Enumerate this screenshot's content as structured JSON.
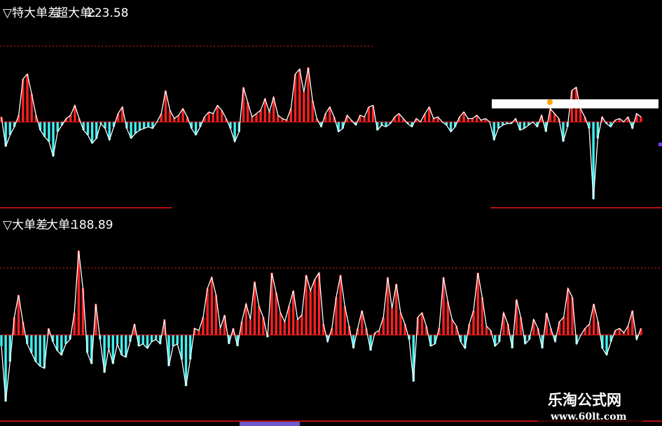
{
  "colors": {
    "background": "#000000",
    "positive": "#ff2020",
    "negative": "#40f0f0",
    "line": "#ffffff",
    "dotted": "#c01818",
    "separator": "#b01010",
    "text": "#ffffff"
  },
  "chart_data": [
    {
      "type": "bar",
      "panel_title": "▽特大单差",
      "readout_label": "超大单:",
      "readout_value": "223.58",
      "values": [
        0.3,
        -1.5,
        -0.8,
        -0.3,
        0.4,
        2.6,
        2.9,
        1.7,
        0.4,
        -0.5,
        -0.9,
        -1.2,
        -2.1,
        -0.6,
        -0.2,
        0.2,
        0.4,
        1.0,
        0.2,
        -0.5,
        -0.8,
        -1.3,
        -1.0,
        -0.1,
        -0.4,
        -1.1,
        -0.3,
        0.5,
        0.9,
        -0.4,
        -1.0,
        -0.7,
        -0.5,
        -0.4,
        -0.3,
        -0.4,
        0.0,
        0.5,
        1.9,
        0.7,
        0.2,
        0.4,
        0.8,
        0.3,
        -0.4,
        -0.8,
        -0.3,
        0.3,
        0.6,
        0.5,
        1.0,
        0.7,
        0.2,
        -0.4,
        -1.2,
        -0.6,
        2.1,
        1.2,
        0.3,
        0.5,
        0.7,
        1.4,
        0.6,
        1.5,
        0.4,
        0.2,
        0.1,
        0.8,
        2.9,
        3.2,
        1.8,
        3.3,
        1.3,
        0.2,
        -0.3,
        0.5,
        0.9,
        0.3,
        -0.6,
        -0.4,
        0.4,
        0.1,
        -0.2,
        0.4,
        0.3,
        0.9,
        1.0,
        -0.5,
        -0.2,
        -0.3,
        -0.1,
        0.3,
        0.5,
        0.2,
        -0.1,
        -0.3,
        0.2,
        0.0,
        0.5,
        0.9,
        0.2,
        0.3,
        0.0,
        -0.2,
        -0.6,
        -0.3,
        0.3,
        0.6,
        0.2,
        0.2,
        0.4,
        0.1,
        0.2,
        0.0,
        -1.1,
        -0.4,
        -0.2,
        -0.1,
        -0.1,
        0.2,
        -0.5,
        -0.4,
        -0.2,
        0.0,
        -0.3,
        0.4,
        -0.6,
        0.8,
        0.5,
        0.2,
        -1.2,
        -0.3,
        1.9,
        2.1,
        0.8,
        0.3,
        -0.4,
        -4.7,
        -1.0,
        0.3,
        -0.1,
        -0.3,
        0.1,
        0.2,
        0.0,
        0.3,
        -0.4,
        0.5,
        0.3
      ],
      "ylim": [
        -5.0,
        4.0
      ]
    },
    {
      "type": "bar",
      "panel_title": "▽大单差",
      "readout_label": "大单:",
      "readout_value": "188.89",
      "values": [
        -0.5,
        -3.0,
        -1.2,
        0.8,
        1.8,
        0.6,
        -0.4,
        -0.8,
        -1.2,
        -1.4,
        -1.5,
        0.3,
        -0.3,
        -0.7,
        -0.9,
        -0.4,
        -0.2,
        1.0,
        3.8,
        2.1,
        -0.8,
        -1.3,
        1.4,
        -0.2,
        -1.7,
        -0.6,
        -1.3,
        -0.4,
        -0.9,
        -1.0,
        -0.3,
        0.5,
        -0.5,
        -0.4,
        -0.6,
        -0.3,
        -0.2,
        -0.4,
        0.7,
        -1.4,
        -0.5,
        -0.4,
        -1.1,
        -2.3,
        -1.1,
        0.3,
        0.2,
        0.8,
        2.1,
        2.6,
        1.8,
        0.3,
        0.9,
        -0.4,
        0.3,
        -0.5,
        0.6,
        1.4,
        0.7,
        2.4,
        1.3,
        0.8,
        -0.1,
        2.8,
        1.9,
        1.0,
        0.6,
        1.3,
        2.0,
        0.7,
        0.9,
        2.7,
        2.0,
        2.5,
        2.8,
        0.5,
        -0.3,
        0.3,
        1.7,
        2.7,
        1.3,
        0.4,
        -0.6,
        0.3,
        1.1,
        0.3,
        -0.7,
        0.1,
        0.2,
        0.8,
        2.6,
        1.2,
        2.3,
        1.0,
        0.5,
        -0.2,
        -2.1,
        0.8,
        1.0,
        0.4,
        -0.5,
        -0.4,
        0.3,
        2.6,
        1.5,
        0.7,
        0.4,
        -0.3,
        -0.6,
        0.5,
        1.1,
        2.8,
        1.7,
        0.4,
        0.2,
        -0.5,
        -0.3,
        1.0,
        0.5,
        -0.6,
        1.6,
        0.8,
        -0.4,
        -0.2,
        0.7,
        0.3,
        -0.6,
        1.0,
        0.3,
        -0.3,
        0.6,
        0.8,
        2.1,
        1.7,
        -0.4,
        0.0,
        0.3,
        0.5,
        1.4,
        0.6,
        -0.6,
        -0.9,
        -0.3,
        0.2,
        0.3,
        0.1,
        0.4,
        1.1,
        -0.2,
        0.3
      ],
      "ylim": [
        -3.5,
        4.0
      ]
    }
  ],
  "watermark": {
    "name": "乐淘公式网",
    "url": "www.60lt.com"
  }
}
